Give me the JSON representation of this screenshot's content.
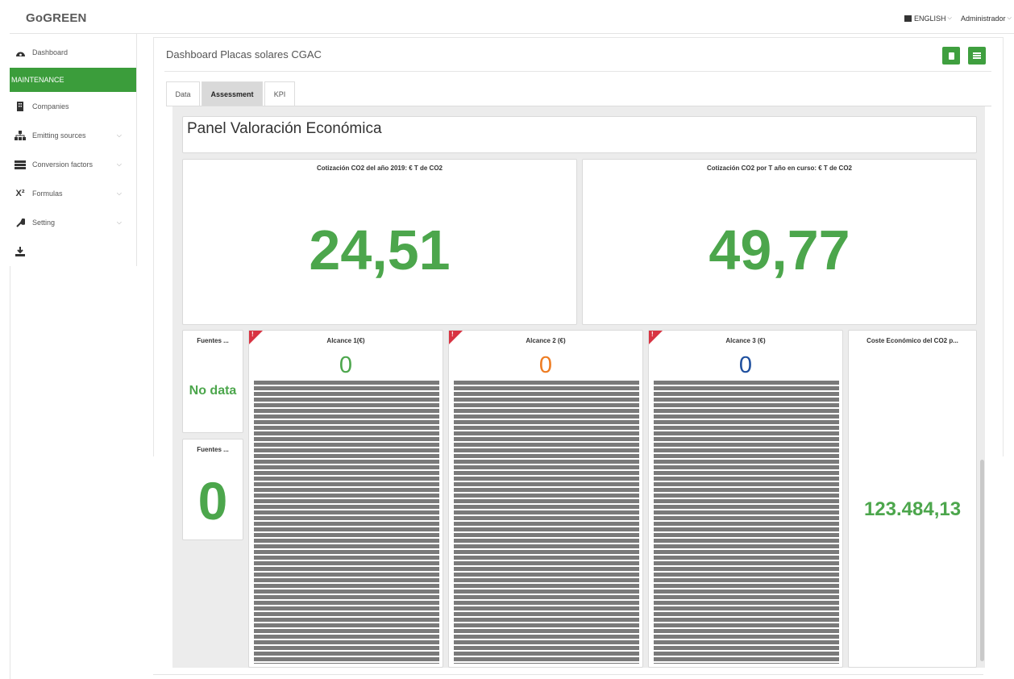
{
  "app": {
    "logo": "GoGREEN"
  },
  "header": {
    "language": "ENGLISH",
    "user": "Administrador"
  },
  "sidebar": {
    "items": [
      {
        "label": "Dashboard",
        "icon": "dashboard-icon"
      },
      {
        "label": "MAINTENANCE",
        "section": true
      },
      {
        "label": "Companies",
        "icon": "building-icon"
      },
      {
        "label": "Emitting sources",
        "icon": "sitemap-icon"
      },
      {
        "label": "Conversion factors",
        "icon": "list-icon"
      },
      {
        "label": "Formulas",
        "icon": "superscript-icon",
        "glyph": "X²"
      },
      {
        "label": "Setting",
        "icon": "wrench-icon"
      },
      {
        "label": "",
        "icon": "download-icon"
      }
    ]
  },
  "main": {
    "title": "Dashboard Placas solares CGAC",
    "tabs": [
      {
        "label": "Data"
      },
      {
        "label": "Assessment",
        "active": true
      },
      {
        "label": "KPI"
      }
    ]
  },
  "dashboard": {
    "panel_title": "Panel Valoración Económica",
    "kpi1": {
      "label": "Cotización CO2 del año 2019: € T de CO2",
      "value": "24,51"
    },
    "kpi2": {
      "label": "Cotización CO2 por T año en curso: € T de CO2",
      "value": "49,77"
    },
    "fuentes1": {
      "label": "Fuentes ...",
      "value": "No data"
    },
    "fuentes2": {
      "label": "Fuentes ...",
      "value": "0"
    },
    "alcance1": {
      "label": "Alcance 1(€)",
      "value": "0",
      "color": "#4ca64c"
    },
    "alcance2": {
      "label": "Alcance 2 (€)",
      "value": "0",
      "color": "#ee7c22"
    },
    "alcance3": {
      "label": "Alcance 3 (€)",
      "value": "0",
      "color": "#1e4f9e"
    },
    "coste": {
      "label": "Coste Económico del CO2 p...",
      "value": "123.484,13"
    },
    "alert_mark": "!"
  },
  "colors": {
    "accent": "#3b9d3b",
    "kpi_green": "#4ca64c",
    "alert": "#d83342"
  }
}
